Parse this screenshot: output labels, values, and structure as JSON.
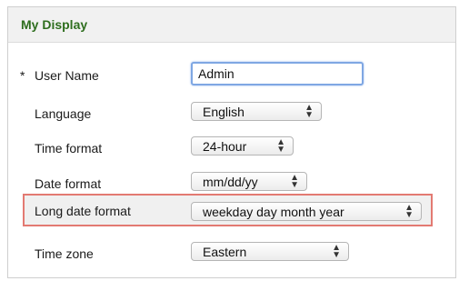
{
  "panel": {
    "title": "My Display"
  },
  "fields": {
    "user_name": {
      "required_mark": "*",
      "label": "User Name",
      "value": "Admin"
    },
    "language": {
      "label": "Language",
      "selected": "English"
    },
    "time_format": {
      "label": "Time format",
      "selected": "24-hour"
    },
    "date_format": {
      "label": "Date format",
      "selected": "mm/dd/yy"
    },
    "long_date_format": {
      "label": "Long date format",
      "selected": "weekday day month year"
    },
    "time_zone": {
      "label": "Time zone",
      "selected": "Eastern"
    }
  },
  "icons": {
    "select_chevron": "up-down-chevron-icon"
  },
  "colors": {
    "title": "#2e6e1e",
    "highlight_border": "#e37a72",
    "input_focus": "#7fa7e3"
  }
}
